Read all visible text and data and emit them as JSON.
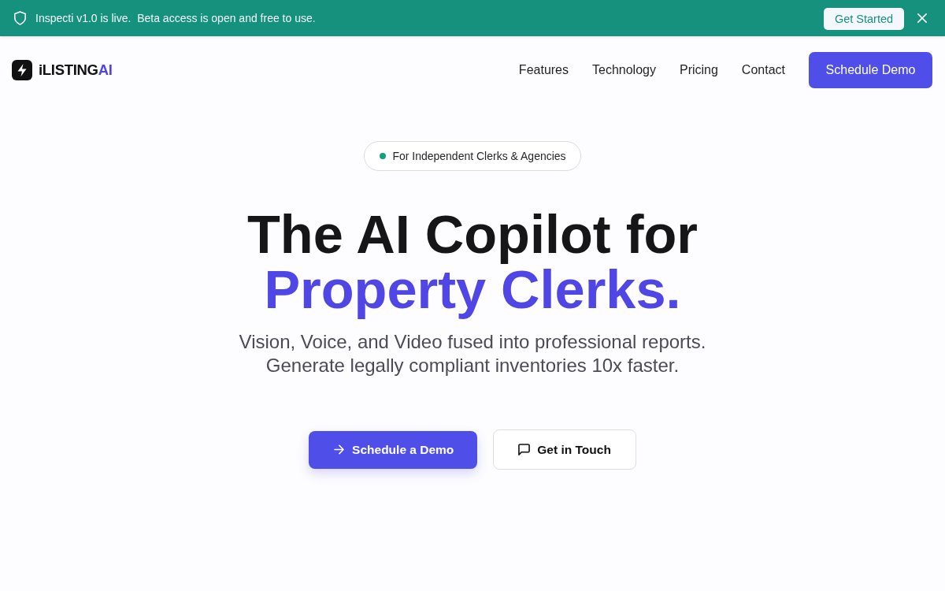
{
  "announcement": {
    "message": "Inspecti v1.0 is live.  Beta access is open and free to use.",
    "button": "Get Started"
  },
  "nav": {
    "brand": {
      "name": "iLISTING",
      "accent": "AI"
    },
    "links": [
      "Features",
      "Technology",
      "Pricing",
      "Contact"
    ],
    "cta": "Schedule Demo"
  },
  "hero": {
    "badge": "For Independent Clerks & Agencies",
    "headline": [
      {
        "text": "The AI Copilot for",
        "accent": false
      },
      {
        "text": "Property Clerks.",
        "accent": true
      }
    ],
    "subtitle": [
      "Vision, Voice, and Video fused into professional reports.",
      "Generate legally compliant inventories 10x faster."
    ],
    "buttons": [
      {
        "label": "Schedule a Demo",
        "kind": "primary"
      },
      {
        "label": "Get in Touch",
        "kind": "secondary"
      }
    ]
  }
}
